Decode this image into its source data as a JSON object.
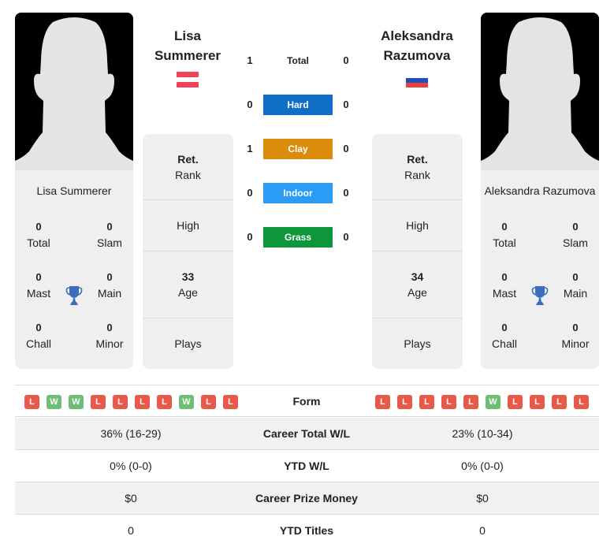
{
  "players": [
    {
      "name": "Lisa Summerer",
      "name_line1": "Lisa",
      "name_line2": "Summerer",
      "flag": "austria-flag",
      "flag_colors": [
        "#ef4158",
        "#ffffff",
        "#ef4158"
      ],
      "titles": {
        "total": {
          "value": "0",
          "label": "Total"
        },
        "slam": {
          "value": "0",
          "label": "Slam"
        },
        "mast": {
          "value": "0",
          "label": "Mast"
        },
        "main": {
          "value": "0",
          "label": "Main"
        },
        "chall": {
          "value": "0",
          "label": "Chall"
        },
        "minor": {
          "value": "0",
          "label": "Minor"
        }
      },
      "info": {
        "rank_value": "Ret.",
        "rank_label": "Rank",
        "high_label": "High",
        "age_value": "33",
        "age_label": "Age",
        "plays_label": "Plays"
      },
      "form": [
        "L",
        "W",
        "W",
        "L",
        "L",
        "L",
        "L",
        "W",
        "L",
        "L"
      ]
    },
    {
      "name": "Aleksandra Razumova",
      "name_line1": "Aleksandra",
      "name_line2": "Razumova",
      "flag": "russia-flag",
      "flag_colors": [
        "#ffffff",
        "#1e4fc2",
        "#e8413c"
      ],
      "titles": {
        "total": {
          "value": "0",
          "label": "Total"
        },
        "slam": {
          "value": "0",
          "label": "Slam"
        },
        "mast": {
          "value": "0",
          "label": "Mast"
        },
        "main": {
          "value": "0",
          "label": "Main"
        },
        "chall": {
          "value": "0",
          "label": "Chall"
        },
        "minor": {
          "value": "0",
          "label": "Minor"
        }
      },
      "info": {
        "rank_value": "Ret.",
        "rank_label": "Rank",
        "high_label": "High",
        "age_value": "34",
        "age_label": "Age",
        "plays_label": "Plays"
      },
      "form": [
        "L",
        "L",
        "L",
        "L",
        "L",
        "W",
        "L",
        "L",
        "L",
        "L"
      ]
    }
  ],
  "h2h": [
    {
      "label": "Total",
      "left": "1",
      "right": "0",
      "color": "transparent"
    },
    {
      "label": "Hard",
      "left": "0",
      "right": "0",
      "color": "#0f6fc6"
    },
    {
      "label": "Clay",
      "left": "1",
      "right": "0",
      "color": "#dc8c0b"
    },
    {
      "label": "Indoor",
      "left": "0",
      "right": "0",
      "color": "#2b9cf5"
    },
    {
      "label": "Grass",
      "left": "0",
      "right": "0",
      "color": "#0e973a"
    }
  ],
  "form_label": "Form",
  "stats": [
    {
      "label": "Career Total W/L",
      "left": "36% (16-29)",
      "right": "23% (10-34)"
    },
    {
      "label": "YTD W/L",
      "left": "0% (0-0)",
      "right": "0% (0-0)"
    },
    {
      "label": "Career Prize Money",
      "left": "$0",
      "right": "$0"
    },
    {
      "label": "YTD Titles",
      "left": "0",
      "right": "0"
    }
  ],
  "colors": {
    "loss": "#e8594a",
    "win": "#6cbf73",
    "trophy": "#3c6ebe",
    "card_bg": "#efefef"
  }
}
